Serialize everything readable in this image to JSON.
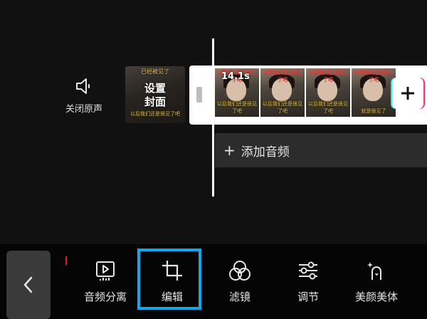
{
  "mute": {
    "label": "关闭原声",
    "icon": "speaker-icon"
  },
  "cover": {
    "label_line1": "设置",
    "label_line2": "封面",
    "caption_top": "已经被见了",
    "caption_bottom": "以后我们还是很见了吧"
  },
  "clip": {
    "duration": "14.1s",
    "thumbs": [
      {
        "top": "以后我们还是很见了吧",
        "bottom": "以后我们还是很见了吧"
      },
      {
        "top": "以后我们还是很见了吧",
        "bottom": "以后我们还是很见了吧"
      },
      {
        "top": "以后我们还是很见了吧",
        "bottom": "以后我们还是很见了吧"
      },
      {
        "top": "以后我们还是很见了吧",
        "bottom": "就是很见了"
      }
    ],
    "add_label": "+"
  },
  "audio": {
    "add_label": "添加音频",
    "plus": "+"
  },
  "toolbar": {
    "back_icon": "chevron-left-icon",
    "tools": [
      {
        "label": "音频分离",
        "icon": "audio-separate-icon"
      },
      {
        "label": "编辑",
        "icon": "crop-icon",
        "selected": true
      },
      {
        "label": "滤镜",
        "icon": "filter-icon"
      },
      {
        "label": "调节",
        "icon": "sliders-icon"
      },
      {
        "label": "美颜美体",
        "icon": "beauty-icon"
      }
    ]
  },
  "colors": {
    "highlight": "#12a9e6",
    "background": "#111111",
    "audio_bar": "#2c2c2c"
  }
}
